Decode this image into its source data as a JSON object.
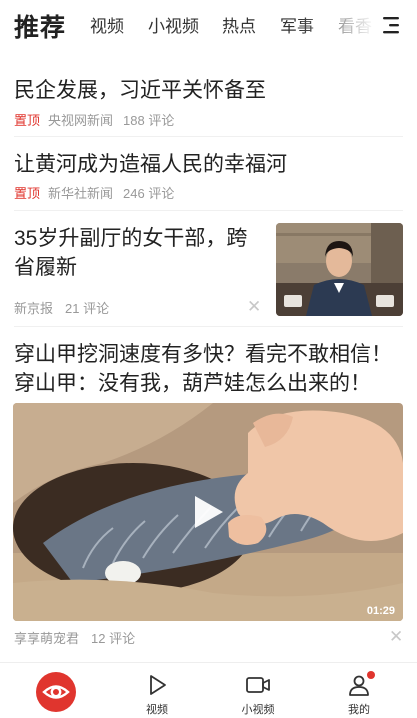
{
  "top_tabs": {
    "active": "推荐",
    "items": [
      "视频",
      "小视频",
      "热点",
      "军事",
      "看香"
    ]
  },
  "feed": [
    {
      "title": "民企发展，习近平关怀备至",
      "pinned_label": "置顶",
      "source": "央视网新闻",
      "comments": "188 评论"
    },
    {
      "title": "让黄河成为造福人民的幸福河",
      "pinned_label": "置顶",
      "source": "新华社新闻",
      "comments": "246 评论"
    },
    {
      "title_line1": "35岁升副厅的女干部，跨",
      "title_line2": "省履新",
      "source": "新京报",
      "comments": "21 评论",
      "image": "woman-official-thumbnail"
    },
    {
      "title_line1": "穿山甲挖洞速度有多快？看完不敢相信！",
      "title_line2": "穿山甲：没有我，葫芦娃怎么出来的！",
      "duration": "01:29",
      "source": "享享萌宠君",
      "comments": "12 评论",
      "image": "pangolin-video-thumbnail"
    }
  ],
  "bottom_nav": {
    "items": [
      {
        "label": "",
        "icon": "eye-logo-icon"
      },
      {
        "label": "视频",
        "icon": "play-icon"
      },
      {
        "label": "小视频",
        "icon": "camera-icon"
      },
      {
        "label": "我的",
        "icon": "user-icon"
      }
    ]
  },
  "colors": {
    "accent": "#e0352e",
    "meta": "#999999",
    "title": "#222222"
  }
}
